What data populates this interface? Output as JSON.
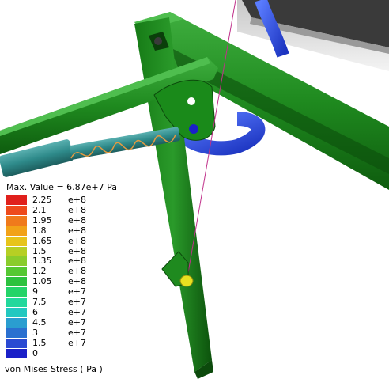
{
  "legend": {
    "max_value": "Max. Value = 6.87e+7 Pa",
    "caption": "von Mises  Stress  ( Pa )",
    "levels": [
      {
        "value": "2.25",
        "exp": "e+8",
        "color": "#e0201c"
      },
      {
        "value": "2.1",
        "exp": "e+8",
        "color": "#ee4a1c"
      },
      {
        "value": "1.95",
        "exp": "e+8",
        "color": "#f07a1c"
      },
      {
        "value": "1.8",
        "exp": "e+8",
        "color": "#f2a218"
      },
      {
        "value": "1.65",
        "exp": "e+8",
        "color": "#e7c41a"
      },
      {
        "value": "1.5",
        "exp": "e+8",
        "color": "#b6cf24"
      },
      {
        "value": "1.35",
        "exp": "e+8",
        "color": "#8acc2c"
      },
      {
        "value": "1.2",
        "exp": "e+8",
        "color": "#55c832"
      },
      {
        "value": "1.05",
        "exp": "e+8",
        "color": "#2cc23e"
      },
      {
        "value": "9",
        "exp": "e+7",
        "color": "#24d468"
      },
      {
        "value": "7.5",
        "exp": "e+7",
        "color": "#22d89c"
      },
      {
        "value": "6",
        "exp": "e+7",
        "color": "#22c8c0"
      },
      {
        "value": "4.5",
        "exp": "e+7",
        "color": "#2a9ed0"
      },
      {
        "value": "3",
        "exp": "e+7",
        "color": "#2a70d0"
      },
      {
        "value": "1.5",
        "exp": "e+7",
        "color": "#2a4ad2"
      },
      {
        "value": "0",
        "exp": "",
        "color": "#1a20c8"
      }
    ]
  },
  "colors": {
    "frame_green": "#1f8a1f",
    "frame_dark": "#0f5a0f",
    "cylinder_teal": "#2e8a8a",
    "tube_blue": "#2a50e0"
  }
}
